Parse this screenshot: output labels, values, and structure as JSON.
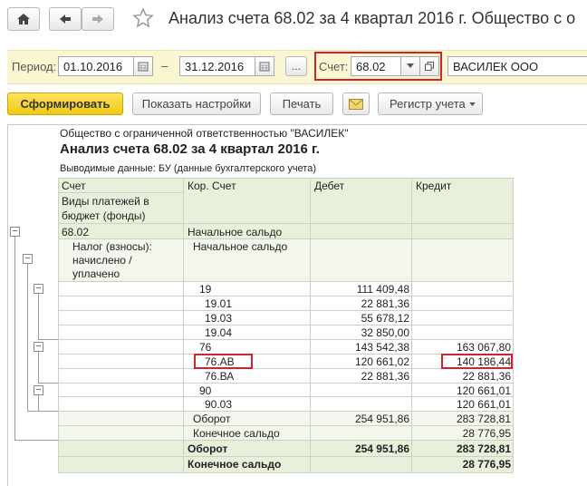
{
  "window": {
    "title": "Анализ счета 68.02 за 4 квартал 2016 г. Общество с о"
  },
  "filters": {
    "period_label": "Период:",
    "date_from": "01.10.2016",
    "dash": "–",
    "date_to": "31.12.2016",
    "more_label": "...",
    "account_label": "Счет:",
    "account_value": "68.02",
    "org_value": "ВАСИЛЕК ООО"
  },
  "toolbar": {
    "generate_label": "Сформировать",
    "settings_label": "Показать настройки",
    "print_label": "Печать",
    "register_label": "Регистр учета"
  },
  "report": {
    "org": "Общество с ограниченной ответственностью \"ВАСИЛЕК\"",
    "title": "Анализ счета 68.02 за 4 квартал 2016 г.",
    "output_data": "Выводимые данные:  БУ (данные бухгалтерского учета)",
    "headers": {
      "account": "Счет",
      "payment_types_1": "Виды платежей в",
      "payment_types_2": "бюджет (фонды)",
      "corr_account": "Кор. Счет",
      "debit": "Дебет",
      "credit": "Кредит"
    },
    "rows": {
      "r1_account": "68.02",
      "r1_corr": "Начальное сальдо",
      "r2_type_1": "Налог (взносы):",
      "r2_type_2": "начислено /",
      "r2_type_3": "уплачено",
      "r2_corr": "Начальное сальдо",
      "r3_corr": "19",
      "r3_debit": "111 409,48",
      "r4_corr": "19.01",
      "r4_debit": "22 881,36",
      "r5_corr": "19.03",
      "r5_debit": "55 678,12",
      "r6_corr": "19.04",
      "r6_debit": "32 850,00",
      "r7_corr": "76",
      "r7_debit": "143 542,38",
      "r7_credit": "163 067,80",
      "r8_corr": "76.АВ",
      "r8_debit": "120 661,02",
      "r8_credit": "140 186,44",
      "r9_corr": "76.ВА",
      "r9_debit": "22 881,36",
      "r9_credit": "22 881,36",
      "r10_corr": "90",
      "r10_credit": "120 661,01",
      "r11_corr": "90.03",
      "r11_credit": "120 661,01",
      "r12_corr": "Оборот",
      "r12_debit": "254 951,86",
      "r12_credit": "283 728,81",
      "r13_corr": "Конечное сальдо",
      "r13_credit": "28 776,95",
      "t1_corr": "Оборот",
      "t1_debit": "254 951,86",
      "t1_credit": "283 728,81",
      "t2_corr": "Конечное сальдо",
      "t2_credit": "28 776,95"
    }
  },
  "colors": {
    "accent_yellow": "#f5d428",
    "highlight_red": "#d2232a",
    "table_green": "#e8f0dc"
  }
}
